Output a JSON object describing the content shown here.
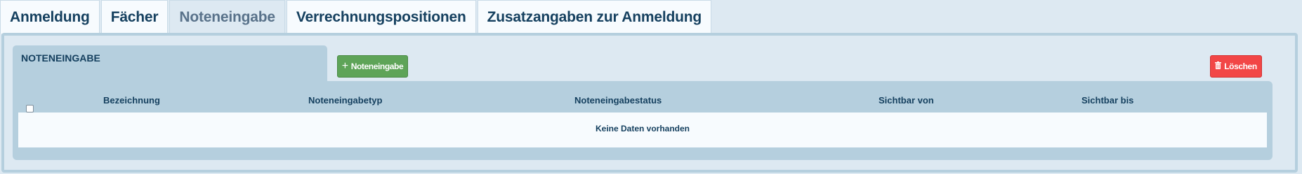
{
  "tabs": [
    {
      "label": "Anmeldung"
    },
    {
      "label": "Fächer"
    },
    {
      "label": "Noteneingabe",
      "active": true
    },
    {
      "label": "Verrechnungspositionen"
    },
    {
      "label": "Zusatzangaben zur Anmeldung"
    }
  ],
  "section": {
    "title": "NOTENEINGABE"
  },
  "toolbar": {
    "add_label": "Noteneingabe",
    "add_icon": "plus-icon",
    "delete_label": "Löschen",
    "delete_icon": "trash-icon",
    "add_color": "#5ea458",
    "delete_color": "#f24646"
  },
  "table": {
    "columns": [
      "Bezeichnung",
      "Noteneingabetyp",
      "Noteneingabestatus",
      "Sichtbar von",
      "Sichtbar bis"
    ],
    "empty_message": "Keine Daten vorhanden",
    "select_all_checked": false
  },
  "colors": {
    "accent": "#15405f",
    "panel": "#b5cfde",
    "background": "#dde9f2"
  }
}
